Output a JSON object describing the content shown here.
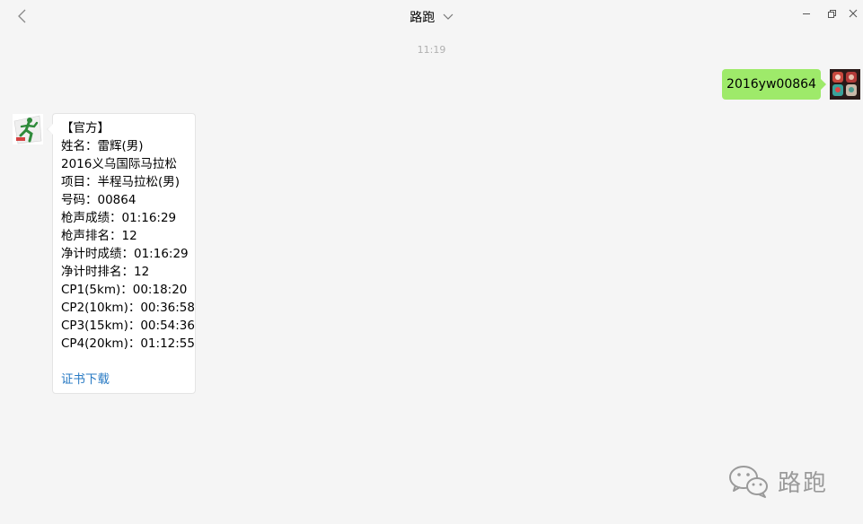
{
  "window": {
    "title": "路跑",
    "back_icon": "chevron-left-icon",
    "dropdown_icon": "chevron-down-icon",
    "minimize_icon": "minimize-icon",
    "restore_icon": "restore-icon",
    "close_icon": "close-icon"
  },
  "chat": {
    "timestamp": "11:19",
    "sent_message": {
      "text": "2016yw00864",
      "bubble_color": "#9eea6a"
    },
    "received_message": {
      "lines": [
        "【官方】",
        "姓名：雷辉(男)",
        "2016义乌国际马拉松",
        "项目：半程马拉松(男)",
        "号码：00864",
        "枪声成绩：01:16:29",
        "枪声排名：12",
        "净计时成绩：01:16:29",
        "净计时排名：12",
        "CP1(5km)：00:18:20",
        "CP2(10km)：00:36:58",
        "CP3(15km)：00:54:36",
        "CP4(20km)：01:12:55"
      ],
      "link_text": "证书下载",
      "link_color": "#2a7bc4"
    }
  },
  "watermark": {
    "text": "路跑",
    "icon": "wechat-logo-icon"
  },
  "colors": {
    "background": "#f5f5f5",
    "timestamp": "#b0b0b0"
  }
}
